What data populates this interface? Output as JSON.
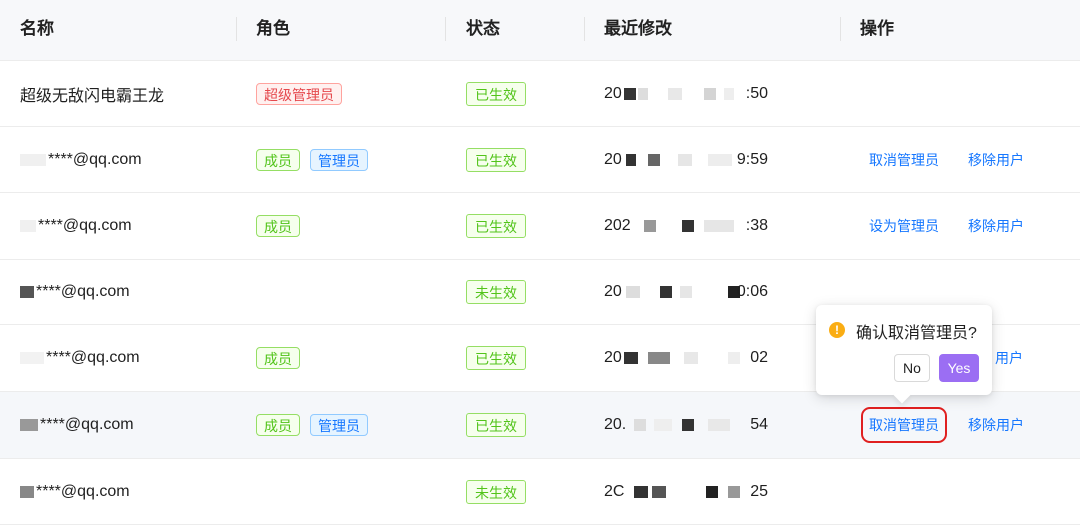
{
  "columns": {
    "name": "名称",
    "role": "角色",
    "status": "状态",
    "modified": "最近修改",
    "actions": "操作"
  },
  "rows": [
    {
      "name": "超级无敌闪电霸王龙",
      "roles": [
        "超级管理员"
      ],
      "status": "已生效",
      "time_head": "20",
      "time_tail": ":50",
      "actions": []
    },
    {
      "name": "****@qq.com",
      "roles": [
        "成员",
        "管理员"
      ],
      "status": "已生效",
      "time_head": "20",
      "time_tail": "9:59",
      "actions": [
        "取消管理员",
        "移除用户"
      ]
    },
    {
      "name": "****@qq.com",
      "roles": [
        "成员"
      ],
      "status": "已生效",
      "time_head": "202",
      "time_tail": ":38",
      "actions": [
        "设为管理员",
        "移除用户"
      ]
    },
    {
      "name": "****@qq.com",
      "roles": [],
      "status": "未生效",
      "time_head": "20",
      "time_tail": "0:06",
      "actions": []
    },
    {
      "name": "****@qq.com",
      "roles": [
        "成员"
      ],
      "status": "已生效",
      "time_head": "20",
      "time_tail": "02",
      "actions": [
        "",
        "用户"
      ]
    },
    {
      "name": "****@qq.com",
      "roles": [
        "成员",
        "管理员"
      ],
      "status": "已生效",
      "time_head": "20.",
      "time_tail": "54",
      "actions": [
        "取消管理员",
        "移除用户"
      ]
    },
    {
      "name": "****@qq.com",
      "roles": [],
      "status": "未生效",
      "time_head": "2C",
      "time_tail": "25",
      "actions": []
    }
  ],
  "popconfirm": {
    "icon": "warning-icon",
    "message": "确认取消管理员?",
    "no_label": "No",
    "yes_label": "Yes"
  },
  "colors": {
    "accent": "#1677ff",
    "confirm": "#9b6ef3",
    "success": "#52c41a",
    "danger": "#e5484d",
    "highlight_box": "#e02020"
  }
}
